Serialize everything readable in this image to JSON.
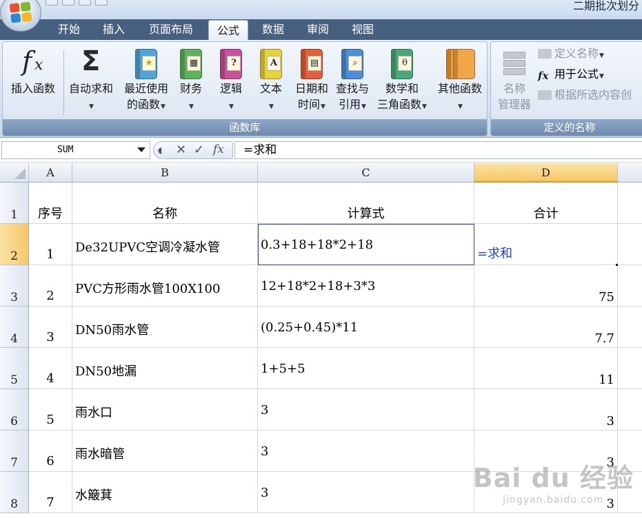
{
  "window": {
    "title_fragment": "二期批次划分"
  },
  "ribbon": {
    "tabs": [
      {
        "label": "开始",
        "active": false
      },
      {
        "label": "插入",
        "active": false
      },
      {
        "label": "页面布局",
        "active": false
      },
      {
        "label": "公式",
        "active": true
      },
      {
        "label": "数据",
        "active": false
      },
      {
        "label": "审阅",
        "active": false
      },
      {
        "label": "视图",
        "active": false
      }
    ],
    "function_library": {
      "label": "函数库",
      "insert_function": {
        "line1": "插入函数"
      },
      "autosum": {
        "line1": "自动求和"
      },
      "recent": {
        "line1": "最近使用",
        "line2": "的函数"
      },
      "financial": {
        "line1": "财务"
      },
      "logical": {
        "line1": "逻辑"
      },
      "text": {
        "line1": "文本"
      },
      "datetime": {
        "line1": "日期和",
        "line2": "时间"
      },
      "lookup": {
        "line1": "查找与",
        "line2": "引用"
      },
      "math": {
        "line1": "数学和",
        "line2": "三角函数"
      },
      "more": {
        "line1": "其他函数"
      }
    },
    "defined_names": {
      "label": "定义的名称",
      "name_manager": {
        "line1": "名称",
        "line2": "管理器"
      },
      "define_name": "定义名称",
      "use_in_formula": "用于公式",
      "create_from_selection": "根据所选内容创"
    }
  },
  "formula_bar": {
    "name_box": "SUM",
    "formula": "=求和"
  },
  "sheet": {
    "columns": [
      "A",
      "B",
      "C",
      "D"
    ],
    "header_row": {
      "row": "1",
      "seq": "序号",
      "name": "名称",
      "formula": "计算式",
      "total": "合计"
    },
    "rows": [
      {
        "row": "2",
        "seq": "1",
        "name": "De32UPVC空调冷凝水管",
        "formula": "0.3+18+18*2+18",
        "total": "=求和"
      },
      {
        "row": "3",
        "seq": "2",
        "name": "PVC方形雨水管100X100",
        "formula": "12+18*2+18+3*3",
        "total": "75"
      },
      {
        "row": "4",
        "seq": "3",
        "name": "DN50雨水管",
        "formula": "(0.25+0.45)*11",
        "total": "7.7"
      },
      {
        "row": "5",
        "seq": "4",
        "name": "DN50地漏",
        "formula": "1+5+5",
        "total": "11"
      },
      {
        "row": "6",
        "seq": "5",
        "name": "雨水口",
        "formula": "3",
        "total": "3"
      },
      {
        "row": "7",
        "seq": "6",
        "name": "雨水暗管",
        "formula": "3",
        "total": "3"
      },
      {
        "row": "8",
        "seq": "7",
        "name": "水簸萁",
        "formula": "3",
        "total": "3"
      }
    ]
  },
  "watermark": {
    "brand": "Bai du 经验",
    "url": "jingyan.baidu.com"
  }
}
